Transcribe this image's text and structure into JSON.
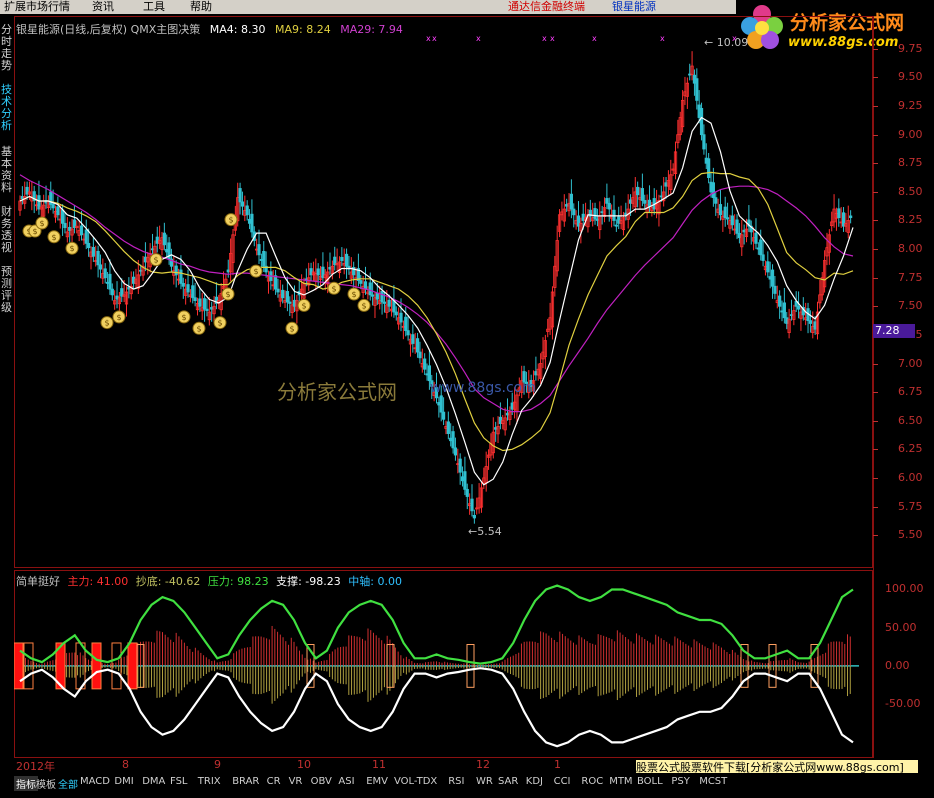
{
  "menu": {
    "items": [
      "扩展市场行情",
      "资讯",
      "工具",
      "帮助"
    ],
    "brand": "通达信金融终端",
    "stock": "银星能源"
  },
  "logo": {
    "title": "分析家公式网",
    "url": "www.88gs.com"
  },
  "side_tabs": [
    {
      "label": "分时走势",
      "active": false
    },
    {
      "label": "技术分析",
      "active": true
    },
    {
      "label": "基本资料",
      "active": false
    },
    {
      "label": "财务透视",
      "active": false
    },
    {
      "label": "预测评级",
      "active": false
    }
  ],
  "main_header": {
    "title": "银星能源(日线,后复权) QMX主图决策",
    "ma4": "MA4: 8.30",
    "ma9": "MA9: 8.24",
    "ma29": "MA29: 7.94"
  },
  "indicator_header": {
    "name": "简单挺好",
    "main": "主力: 41.00",
    "bottom": "抄底: -40.62",
    "pressure": "压力: 98.23",
    "support": "支撑: -98.23",
    "axis": "中轴: 0.00"
  },
  "watermark": {
    "text": "分析家公式网",
    "url": "www.88gs.com"
  },
  "ad_box": "股票公式股票软件下载[分析家公式网www.88gs.com]",
  "date_labels": [
    "2012年",
    "8",
    "9",
    "10",
    "11",
    "12",
    "1"
  ],
  "bottom_tabs": [
    "指标",
    "模板",
    "全部",
    "MACD",
    "DMI",
    "DMA",
    "FSL",
    "TRIX",
    "BRAR",
    "CR",
    "VR",
    "OBV",
    "ASI",
    "EMV",
    "VOL-TDX",
    "RSI",
    "WR",
    "SAR",
    "KDJ",
    "CCI",
    "ROC",
    "MTM",
    "BOLL",
    "PSY",
    "MCST"
  ],
  "colors": {
    "up": "#ff3030",
    "down": "#30c0d0",
    "ma4": "#ffffff",
    "ma9": "#e0d040",
    "ma29": "#c020c0",
    "strong": "#40e040",
    "weak": "#ffffff"
  },
  "chart_data": [
    {
      "type": "candlestick",
      "title": "银星能源(日线,后复权) QMX主图决策",
      "ylim": [
        5.3,
        9.95
      ],
      "yticks": [
        5.5,
        5.75,
        6.0,
        6.25,
        6.5,
        6.75,
        7.0,
        7.25,
        7.5,
        7.75,
        8.0,
        8.25,
        8.5,
        8.75,
        9.0,
        9.25,
        9.5,
        9.75
      ],
      "current_price": "7.28",
      "max_label": "10.09",
      "min_label": "5.54",
      "close_path": [
        8.42,
        8.5,
        8.35,
        8.42,
        8.3,
        8.15,
        8.2,
        8.05,
        7.9,
        7.75,
        7.55,
        7.6,
        7.7,
        7.85,
        8.0,
        8.1,
        7.85,
        7.7,
        7.6,
        7.5,
        7.45,
        7.55,
        7.8,
        8.45,
        8.3,
        8.0,
        7.8,
        7.65,
        7.55,
        7.5,
        7.7,
        7.8,
        7.75,
        7.85,
        7.9,
        7.8,
        7.7,
        7.6,
        7.55,
        7.5,
        7.4,
        7.25,
        7.1,
        6.9,
        6.7,
        6.45,
        6.2,
        5.9,
        5.65,
        6.0,
        6.4,
        6.5,
        6.6,
        6.85,
        6.8,
        7.0,
        7.4,
        8.3,
        8.4,
        8.2,
        8.3,
        8.25,
        8.4,
        8.2,
        8.3,
        8.5,
        8.4,
        8.35,
        8.5,
        8.7,
        9.3,
        9.6,
        9.0,
        8.5,
        8.3,
        8.25,
        8.1,
        8.2,
        8.0,
        7.8,
        7.55,
        7.35,
        7.5,
        7.4,
        7.3,
        7.9,
        8.35,
        8.2,
        8.3
      ],
      "ma4": [
        8.42,
        8.46,
        8.42,
        8.42,
        8.39,
        8.3,
        8.27,
        8.18,
        8.08,
        7.97,
        7.81,
        7.7,
        7.65,
        7.68,
        7.79,
        7.91,
        7.95,
        7.91,
        7.81,
        7.66,
        7.56,
        7.53,
        7.58,
        7.81,
        8.0,
        8.14,
        8.14,
        7.94,
        7.75,
        7.63,
        7.6,
        7.64,
        7.69,
        7.78,
        7.83,
        7.83,
        7.81,
        7.75,
        7.66,
        7.59,
        7.51,
        7.42,
        7.31,
        7.16,
        6.99,
        6.79,
        6.56,
        6.31,
        6.05,
        5.94,
        5.99,
        6.14,
        6.38,
        6.59,
        6.69,
        6.81,
        7.01,
        7.38,
        7.73,
        8.08,
        8.3,
        8.29,
        8.29,
        8.29,
        8.29,
        8.35,
        8.35,
        8.39,
        8.44,
        8.49,
        8.71,
        9.03,
        9.15,
        9.1,
        8.85,
        8.51,
        8.29,
        8.21,
        8.14,
        8.03,
        7.89,
        7.68,
        7.55,
        7.45,
        7.39,
        7.51,
        7.74,
        7.94,
        8.19
      ],
      "ma9": [
        8.42,
        8.46,
        8.42,
        8.42,
        8.4,
        8.36,
        8.33,
        8.29,
        8.24,
        8.16,
        8.07,
        7.98,
        7.9,
        7.84,
        7.8,
        7.79,
        7.8,
        7.79,
        7.77,
        7.75,
        7.72,
        7.69,
        7.69,
        7.77,
        7.82,
        7.84,
        7.84,
        7.84,
        7.81,
        7.75,
        7.7,
        7.69,
        7.65,
        7.67,
        7.71,
        7.73,
        7.74,
        7.74,
        7.71,
        7.68,
        7.65,
        7.59,
        7.51,
        7.4,
        7.26,
        7.1,
        6.91,
        6.69,
        6.48,
        6.35,
        6.28,
        6.24,
        6.25,
        6.29,
        6.35,
        6.42,
        6.57,
        6.86,
        7.16,
        7.39,
        7.6,
        7.77,
        7.94,
        8.03,
        8.11,
        8.24,
        8.32,
        8.32,
        8.32,
        8.36,
        8.46,
        8.6,
        8.66,
        8.67,
        8.66,
        8.66,
        8.63,
        8.61,
        8.53,
        8.39,
        8.18,
        7.97,
        7.88,
        7.82,
        7.75,
        7.73,
        7.79,
        7.78,
        7.81
      ],
      "ma29": [
        8.65,
        8.6,
        8.56,
        8.52,
        8.47,
        8.42,
        8.37,
        8.32,
        8.26,
        8.19,
        8.13,
        8.07,
        8.02,
        7.98,
        7.95,
        7.93,
        7.9,
        7.87,
        7.85,
        7.82,
        7.8,
        7.79,
        7.78,
        7.79,
        7.79,
        7.78,
        7.77,
        7.76,
        7.75,
        7.74,
        7.73,
        7.72,
        7.71,
        7.7,
        7.69,
        7.68,
        7.66,
        7.64,
        7.61,
        7.58,
        7.54,
        7.49,
        7.43,
        7.36,
        7.27,
        7.17,
        7.05,
        6.92,
        6.78,
        6.7,
        6.65,
        6.6,
        6.58,
        6.58,
        6.6,
        6.65,
        6.72,
        6.85,
        6.98,
        7.1,
        7.22,
        7.35,
        7.47,
        7.57,
        7.67,
        7.77,
        7.86,
        7.94,
        8.02,
        8.1,
        8.22,
        8.34,
        8.42,
        8.48,
        8.52,
        8.54,
        8.55,
        8.55,
        8.54,
        8.52,
        8.48,
        8.42,
        8.36,
        8.29,
        8.2,
        8.1,
        8.02,
        7.96,
        7.94
      ],
      "signal_markers": [
        15,
        21,
        28,
        40,
        58,
        93,
        105,
        142,
        170,
        185,
        206,
        214,
        217,
        242,
        278,
        290,
        320,
        340,
        350
      ]
    },
    {
      "type": "line",
      "title": "简单挺好",
      "ylim": [
        -110,
        115
      ],
      "yticks": [
        100.0,
        50.0,
        0.0,
        -50.0
      ],
      "series": [
        {
          "name": "压力",
          "values": [
            20,
            10,
            5,
            15,
            30,
            40,
            20,
            8,
            5,
            10,
            30,
            60,
            80,
            90,
            85,
            70,
            50,
            30,
            10,
            15,
            40,
            60,
            75,
            85,
            80,
            60,
            30,
            10,
            20,
            50,
            70,
            80,
            85,
            80,
            60,
            30,
            10,
            10,
            15,
            10,
            8,
            5,
            3,
            5,
            10,
            30,
            60,
            85,
            100,
            105,
            100,
            90,
            85,
            90,
            100,
            100,
            95,
            90,
            85,
            80,
            70,
            65,
            60,
            60,
            55,
            40,
            20,
            10,
            10,
            15,
            20,
            10,
            10,
            30,
            60,
            90,
            100
          ]
        },
        {
          "name": "支撑",
          "values": [
            -20,
            -10,
            -5,
            -15,
            -30,
            -40,
            -20,
            -8,
            -5,
            -10,
            -30,
            -60,
            -80,
            -90,
            -85,
            -70,
            -50,
            -30,
            -10,
            -15,
            -40,
            -60,
            -75,
            -85,
            -80,
            -60,
            -30,
            -10,
            -20,
            -50,
            -70,
            -80,
            -85,
            -80,
            -60,
            -30,
            -10,
            -10,
            -15,
            -10,
            -8,
            -5,
            -3,
            -5,
            -10,
            -30,
            -60,
            -85,
            -100,
            -105,
            -100,
            -90,
            -85,
            -90,
            -100,
            -100,
            -95,
            -90,
            -85,
            -80,
            -70,
            -65,
            -60,
            -60,
            -55,
            -40,
            -20,
            -10,
            -10,
            -15,
            -20,
            -10,
            -10,
            -30,
            -60,
            -90,
            -100
          ]
        },
        {
          "name": "主力",
          "values": [
            15,
            8,
            3,
            10,
            18,
            25,
            12,
            5,
            3,
            8,
            20,
            35,
            45,
            52,
            48,
            38,
            25,
            15,
            5,
            10,
            25,
            38,
            48,
            55,
            50,
            35,
            15,
            5,
            12,
            30,
            42,
            50,
            52,
            48,
            35,
            15,
            5,
            5,
            8,
            5,
            4,
            3,
            2,
            3,
            6,
            18,
            35,
            45,
            50,
            48,
            45,
            42,
            40,
            45,
            50,
            48,
            45,
            44,
            43,
            42,
            40,
            38,
            35,
            33,
            30,
            22,
            12,
            6,
            5,
            8,
            12,
            6,
            6,
            18,
            35,
            45,
            42
          ]
        },
        {
          "name": "抄底",
          "values": [
            -12,
            -6,
            -3,
            -9,
            -16,
            -22,
            -10,
            -4,
            -2,
            -7,
            -18,
            -32,
            -40,
            -48,
            -45,
            -35,
            -24,
            -14,
            -5,
            -9,
            -24,
            -36,
            -46,
            -52,
            -48,
            -33,
            -14,
            -5,
            -11,
            -28,
            -40,
            -48,
            -50,
            -46,
            -33,
            -14,
            -5,
            -5,
            -7,
            -5,
            -4,
            -3,
            -2,
            -3,
            -5,
            -16,
            -33,
            -43,
            -48,
            -46,
            -43,
            -40,
            -38,
            -43,
            -48,
            -46,
            -43,
            -42,
            -41,
            -40,
            -38,
            -36,
            -33,
            -31,
            -28,
            -20,
            -11,
            -5,
            -5,
            -7,
            -11,
            -5,
            -5,
            -16,
            -33,
            -43,
            -40
          ]
        }
      ],
      "signal_bars": [
        4,
        14,
        46,
        66,
        82,
        102,
        118
      ]
    }
  ]
}
